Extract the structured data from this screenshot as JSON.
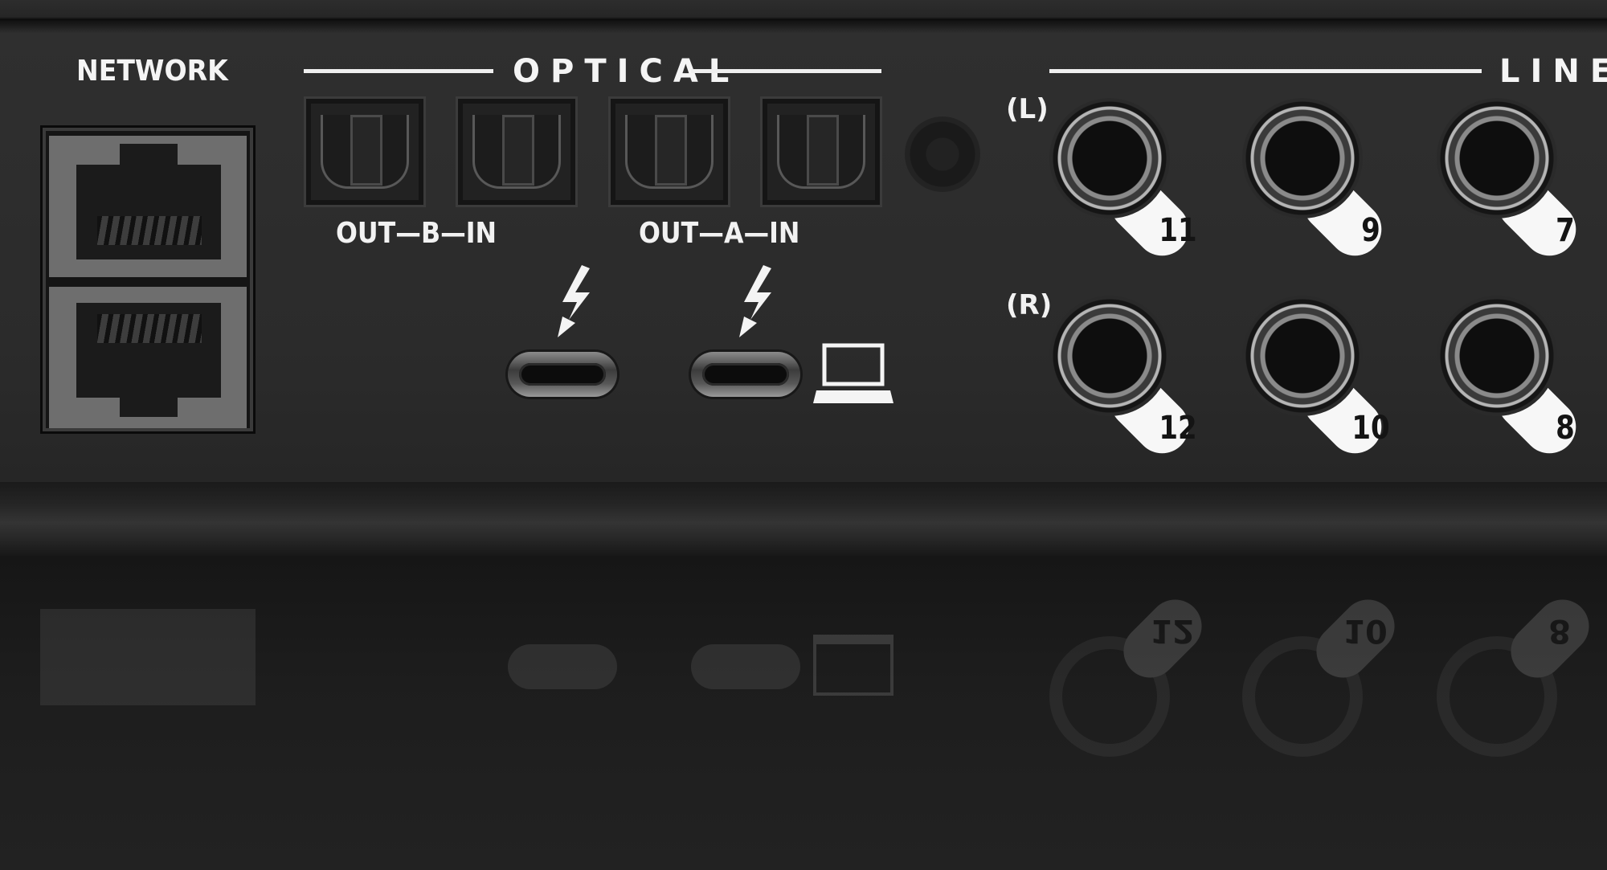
{
  "labels": {
    "network": "NETWORK",
    "optical": "OPTICAL",
    "line": "LINE",
    "optical_b": "OUT—B—IN",
    "optical_a": "OUT—A—IN",
    "left_channel": "(L)",
    "right_channel": "(R)"
  },
  "line_jacks": {
    "top_row": [
      "11",
      "9",
      "7"
    ],
    "bottom_row": [
      "12",
      "10",
      "8"
    ]
  },
  "icons": {
    "thunderbolt": "thunderbolt-icon",
    "computer": "laptop-icon"
  },
  "colors": {
    "panel": "#2b2b2b",
    "text": "#f2f2f2",
    "jack_tab": "#f7f7f7"
  }
}
